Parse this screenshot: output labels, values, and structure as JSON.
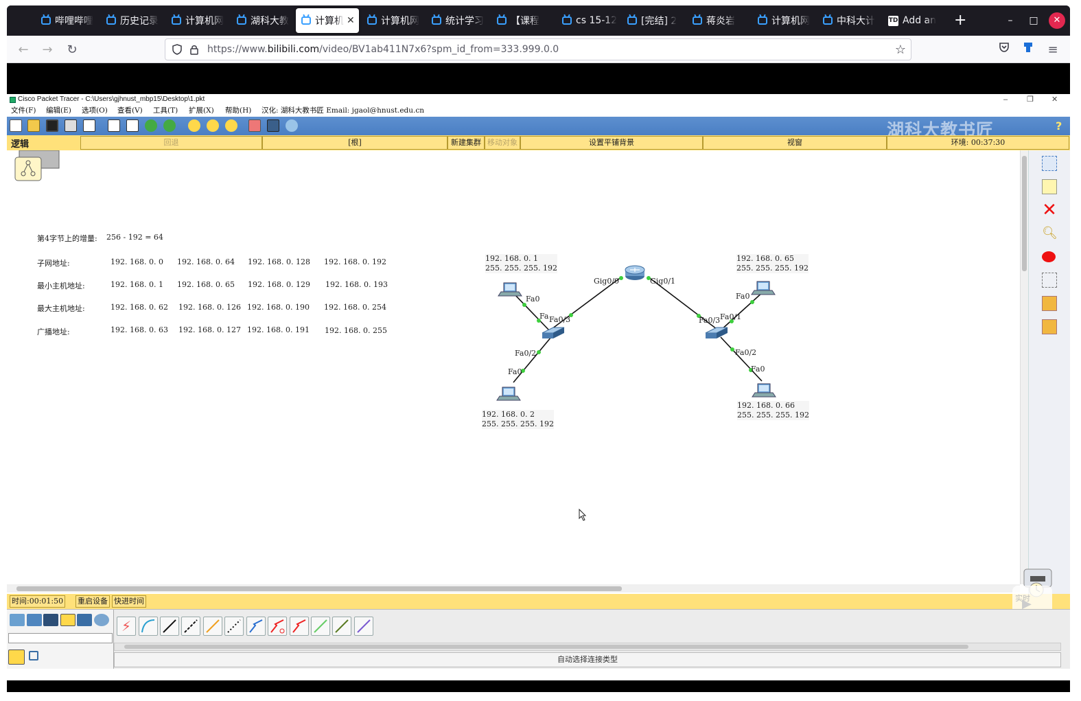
{
  "browser": {
    "tabs": [
      {
        "label": "哔哩哔哩"
      },
      {
        "label": "历史记录"
      },
      {
        "label": "计算机网"
      },
      {
        "label": "湖科大教"
      },
      {
        "label": "计算机",
        "active": true
      },
      {
        "label": "计算机网"
      },
      {
        "label": "统计学习"
      },
      {
        "label": "【课程"
      },
      {
        "label": "cs 15-12"
      },
      {
        "label": "[完结] 2"
      },
      {
        "label": "蒋炎岩"
      },
      {
        "label": "计算机网"
      },
      {
        "label": "中科大计"
      },
      {
        "label": "Add an"
      }
    ],
    "new_tab": "+",
    "window_controls": {
      "minimize": "–",
      "maximize": "□",
      "close": "✕"
    },
    "url_prefix": "https://www.",
    "url_host": "bilibili.com",
    "url_path": "/video/BV1ab411N7x6?spm_id_from=333.999.0.0"
  },
  "pt": {
    "title": "Cisco Packet Tracer - C:\\Users\\gjhnust_mbp15\\Desktop\\1.pkt",
    "window_controls": {
      "minimize": "–",
      "restore": "❐",
      "close": "✕"
    },
    "menu": [
      "文件(F)",
      "编辑(E)",
      "选项(O)",
      "查看(V)",
      "工具(T)",
      "扩展(X)",
      "帮助(H)"
    ],
    "menu_info": "汉化: 湖科大教书匠    Email: jgaol@hnust.edu.cn",
    "watermark": "湖科大教书匠",
    "help": "?",
    "logic_bar": {
      "label": "逻辑",
      "back": "回退",
      "root": "[根]",
      "new_cluster": "新建集群",
      "move_object": "移动对象",
      "set_background": "设置平铺背景",
      "viewport": "视窗",
      "environment": "环境: 00:37:30"
    },
    "subnet_table": {
      "increment_label": "第4字节上的增量:",
      "increment_expr": "256  -  192  =  64",
      "rows": [
        {
          "label": "子网地址:",
          "values": [
            "192. 168. 0. 0",
            "192. 168. 0. 64",
            "192. 168. 0. 128",
            "192. 168. 0. 192"
          ]
        },
        {
          "label": "最小主机地址:",
          "values": [
            "192. 168. 0. 1",
            "192. 168. 0. 65",
            "192. 168. 0. 129",
            "192. 168. 0. 193"
          ]
        },
        {
          "label": "最大主机地址:",
          "values": [
            "192. 168. 0. 62",
            "192. 168. 0. 126",
            "192. 168. 0. 190",
            "192. 168. 0. 254"
          ]
        },
        {
          "label": "广播地址:",
          "values": [
            "192. 168. 0. 63",
            "192. 168. 0. 127",
            "192. 168. 0. 191",
            "192. 168. 0. 255"
          ]
        }
      ]
    },
    "topology": {
      "pc1": {
        "ip": "192. 168. 0. 1",
        "mask": "255. 255. 255. 192"
      },
      "pc2": {
        "ip": "192. 168. 0. 2",
        "mask": "255. 255. 255. 192"
      },
      "pc3": {
        "ip": "192. 168. 0. 65",
        "mask": "255. 255. 255. 192"
      },
      "pc4": {
        "ip": "192. 168. 0. 66",
        "mask": "255. 255. 255. 192"
      },
      "ports": {
        "router_left": "Gig0/0",
        "router_right": "Gig0/1",
        "sw1_up": "Fa0/3",
        "sw1_pc1": "Fa",
        "pc1_nic": "Fa0",
        "sw1_pc2": "Fa0/2",
        "pc2_nic": "Fa0",
        "sw2_up": "Fa0/3",
        "sw2_pc3": "Fa0/1",
        "pc3_nic": "Fa0",
        "sw2_pc4": "Fa0/2",
        "pc4_nic": "Fa0"
      }
    },
    "time_bar": {
      "time": "时间:00:01:50",
      "reboot": "重启设备",
      "fast_forward": "快进时间",
      "realtime": "实时"
    },
    "connection_status": "自动选择连接类型",
    "colors": {
      "yellow_bar": "#ffe17a",
      "toolbar_blue": "#5b8dcd",
      "link_up": "#3ecf3e"
    }
  }
}
